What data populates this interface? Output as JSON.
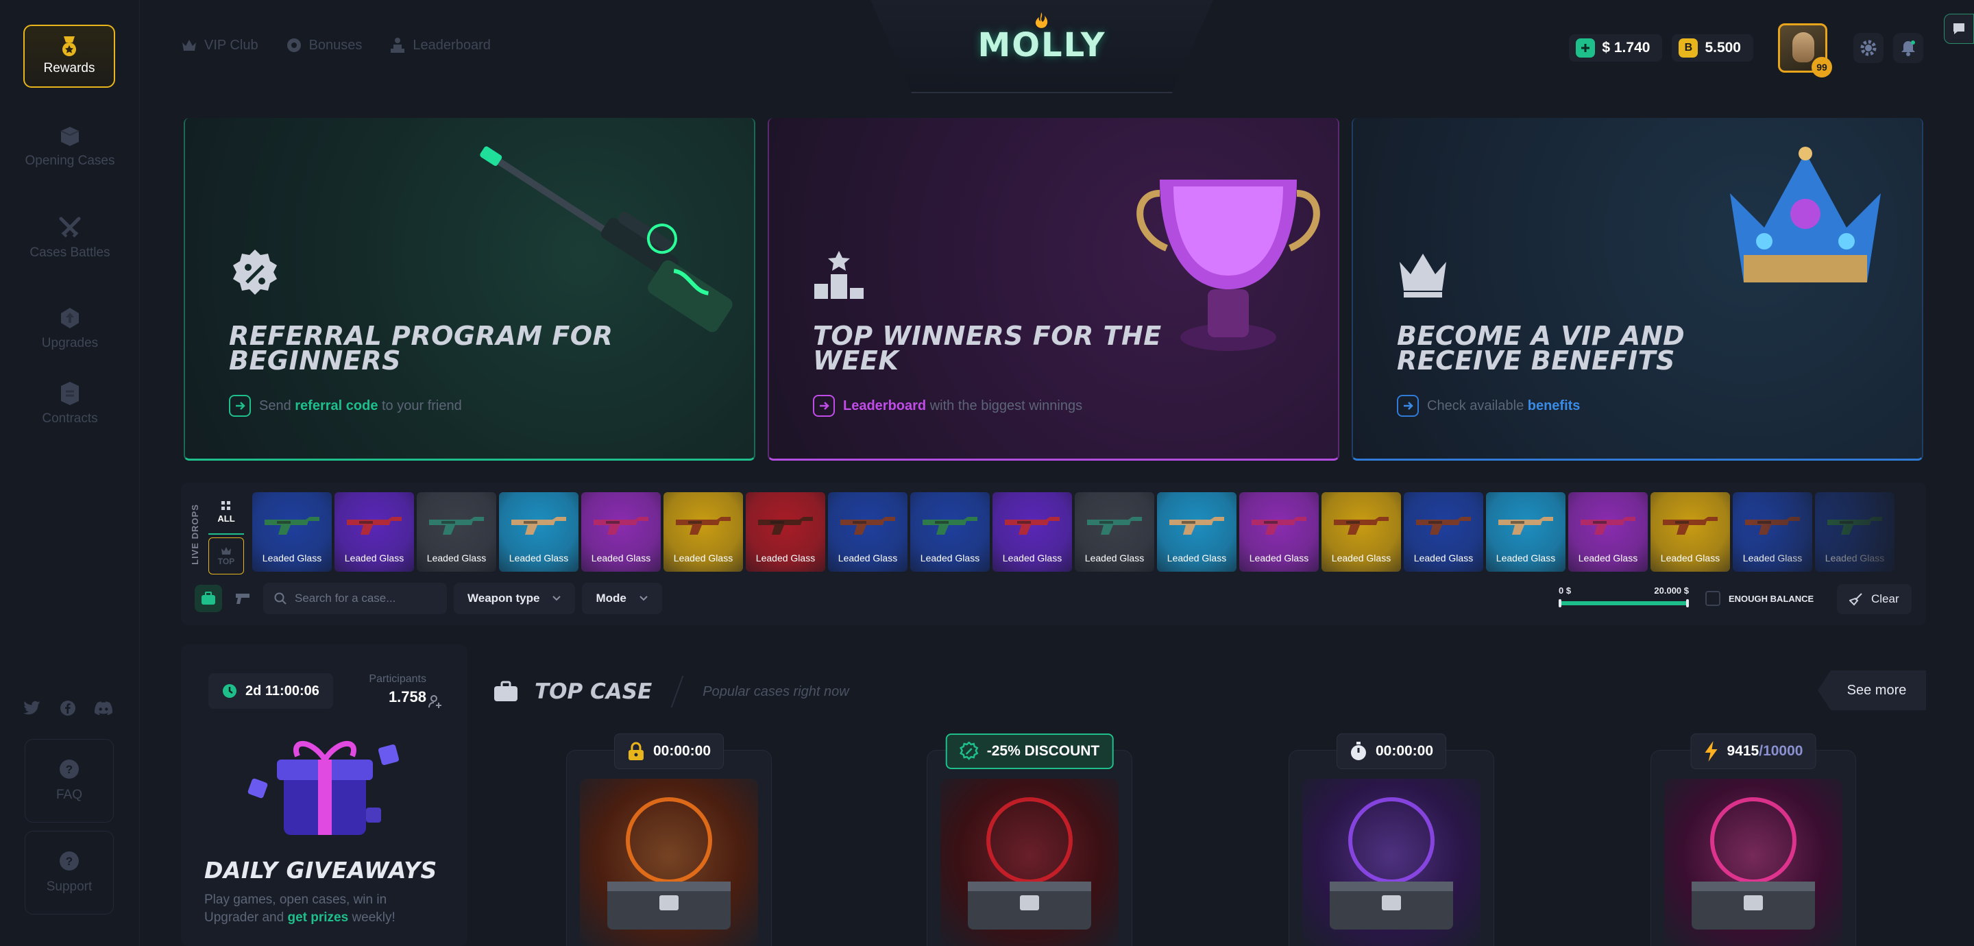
{
  "sidebar": {
    "rewards_label": "Rewards",
    "items": [
      {
        "label": "Opening Cases",
        "icon": "box-icon"
      },
      {
        "label": "Cases Battles",
        "icon": "crossed-swords-icon"
      },
      {
        "label": "Upgrades",
        "icon": "upgrade-icon"
      },
      {
        "label": "Contracts",
        "icon": "contract-icon"
      }
    ],
    "socials": [
      "twitter-icon",
      "facebook-icon",
      "discord-icon"
    ],
    "faq_label": "FAQ",
    "support_label": "Support"
  },
  "header": {
    "nav": [
      {
        "label": "VIP Club",
        "icon": "crown-icon"
      },
      {
        "label": "Bonuses",
        "icon": "gear-badge-icon"
      },
      {
        "label": "Leaderboard",
        "icon": "podium-icon"
      }
    ],
    "logo_text": "MOLLY",
    "balance_usd": "$ 1.740",
    "balance_bonus": "5.500",
    "bonus_chip": "B",
    "user_level": "99"
  },
  "banners": [
    {
      "title": "REFERRAL PROGRAM FOR\nBEGINNERS",
      "sub_pre": "Send ",
      "sub_hl": "referral code",
      "sub_post": " to your friend",
      "hl_color": "#1fbf8c"
    },
    {
      "title": "TOP WINNERS FOR THE\nWEEK",
      "sub_pre": "",
      "sub_hl": "Leaderboard",
      "sub_post": " with the biggest winnings",
      "hl_color": "#c04de8"
    },
    {
      "title": "BECOME A VIP AND\nRECEIVE BENEFITS",
      "sub_pre": "Check available ",
      "sub_hl": "benefits",
      "sub_post": "",
      "hl_color": "#3a8be6"
    }
  ],
  "live_drops": {
    "label": "LIVE DROPS",
    "filter_all": "ALL",
    "filter_top": "TOP",
    "item_name": "Leaded Glass",
    "items": [
      {
        "bg": "#1e3f9e",
        "gun": "#2f7a4a"
      },
      {
        "bg": "#5a27b8",
        "gun": "#b02a3a"
      },
      {
        "bg": "#3a3f48",
        "gun": "#2f7a6a"
      },
      {
        "bg": "#1d8ec0",
        "gun": "#caa070"
      },
      {
        "bg": "#8a2cb0",
        "gun": "#b02a6a"
      },
      {
        "bg": "#c99c12",
        "gun": "#8a3a1a"
      },
      {
        "bg": "#a81c26",
        "gun": "#4a2018"
      },
      {
        "bg": "#1e3f9e",
        "gun": "#7a3a2a"
      },
      {
        "bg": "#1e3f9e",
        "gun": "#2f7a4a"
      },
      {
        "bg": "#5a27b8",
        "gun": "#b02a3a"
      },
      {
        "bg": "#3a3f48",
        "gun": "#2f7a6a"
      },
      {
        "bg": "#1d8ec0",
        "gun": "#caa070"
      },
      {
        "bg": "#8a2cb0",
        "gun": "#b02a6a"
      },
      {
        "bg": "#c99c12",
        "gun": "#8a3a1a"
      },
      {
        "bg": "#1e3f9e",
        "gun": "#7a3a2a"
      },
      {
        "bg": "#1d8ec0",
        "gun": "#caa070"
      },
      {
        "bg": "#8a2cb0",
        "gun": "#b02a6a"
      },
      {
        "bg": "#c99c12",
        "gun": "#8a3a1a"
      },
      {
        "bg": "#1e3f9e",
        "gun": "#7a3a2a"
      },
      {
        "bg": "#1e3f9e",
        "gun": "#2f7a4a"
      }
    ],
    "search_placeholder": "Search for a case...",
    "weapon_type_label": "Weapon type",
    "mode_label": "Mode",
    "range_min": "0 $",
    "range_max": "20.000 $",
    "range_fill": 1.0,
    "enough_label": "ENOUGH BALANCE",
    "clear_label": "Clear"
  },
  "giveaway": {
    "timer": "2d 11:00:06",
    "participants_label": "Participants",
    "participants_value": "1.758",
    "title": "DAILY GIVEAWAYS",
    "desc_pre": "Play games, open cases, win in Upgrader and ",
    "desc_hl": "get prizes",
    "desc_post": " weekly!"
  },
  "top_case": {
    "title": "TOP CASE",
    "subtitle": "Popular cases right now",
    "see_more": "See more",
    "cases": [
      {
        "badge": "00:00:00",
        "badge_icon": "lock-icon",
        "art": "#4a1e10",
        "glow": "#ff7a1a"
      },
      {
        "badge": "-25% DISCOUNT",
        "badge_icon": "discount-gear-icon",
        "art": "#3a1014",
        "glow": "#e0202a"
      },
      {
        "badge": "00:00:00",
        "badge_icon": "stopwatch-icon",
        "art": "#2a1648",
        "glow": "#9a4dff"
      },
      {
        "badge": "9415",
        "badge_sub": "/10000",
        "badge_icon": "lightning-icon",
        "art": "#3a0e30",
        "glow": "#ff3aa0"
      }
    ]
  },
  "colors": {
    "accent": "#1fbf8c",
    "gold": "#e8b51c",
    "bg": "#161a23"
  }
}
